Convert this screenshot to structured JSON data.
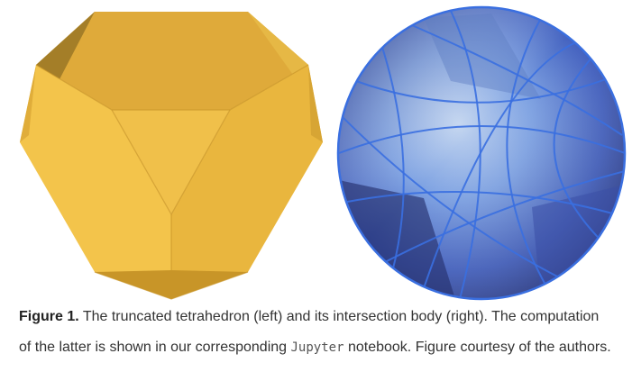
{
  "figure": {
    "label": "Figure 1.",
    "caption_part1": " The truncated tetrahedron (left) and its intersection body (right). The computation of the latter is shown in our corresponding ",
    "caption_code": "Jupyter",
    "caption_part2": " notebook. Figure courtesy of the authors.",
    "colors": {
      "polyhedron_light": "#f4c44c",
      "polyhedron_mid": "#e8b83a",
      "polyhedron_dark": "#a07c26",
      "sphere_dark": "#26327a",
      "sphere_light": "#8ab0e8",
      "sphere_edge": "#3a6fe0"
    }
  }
}
